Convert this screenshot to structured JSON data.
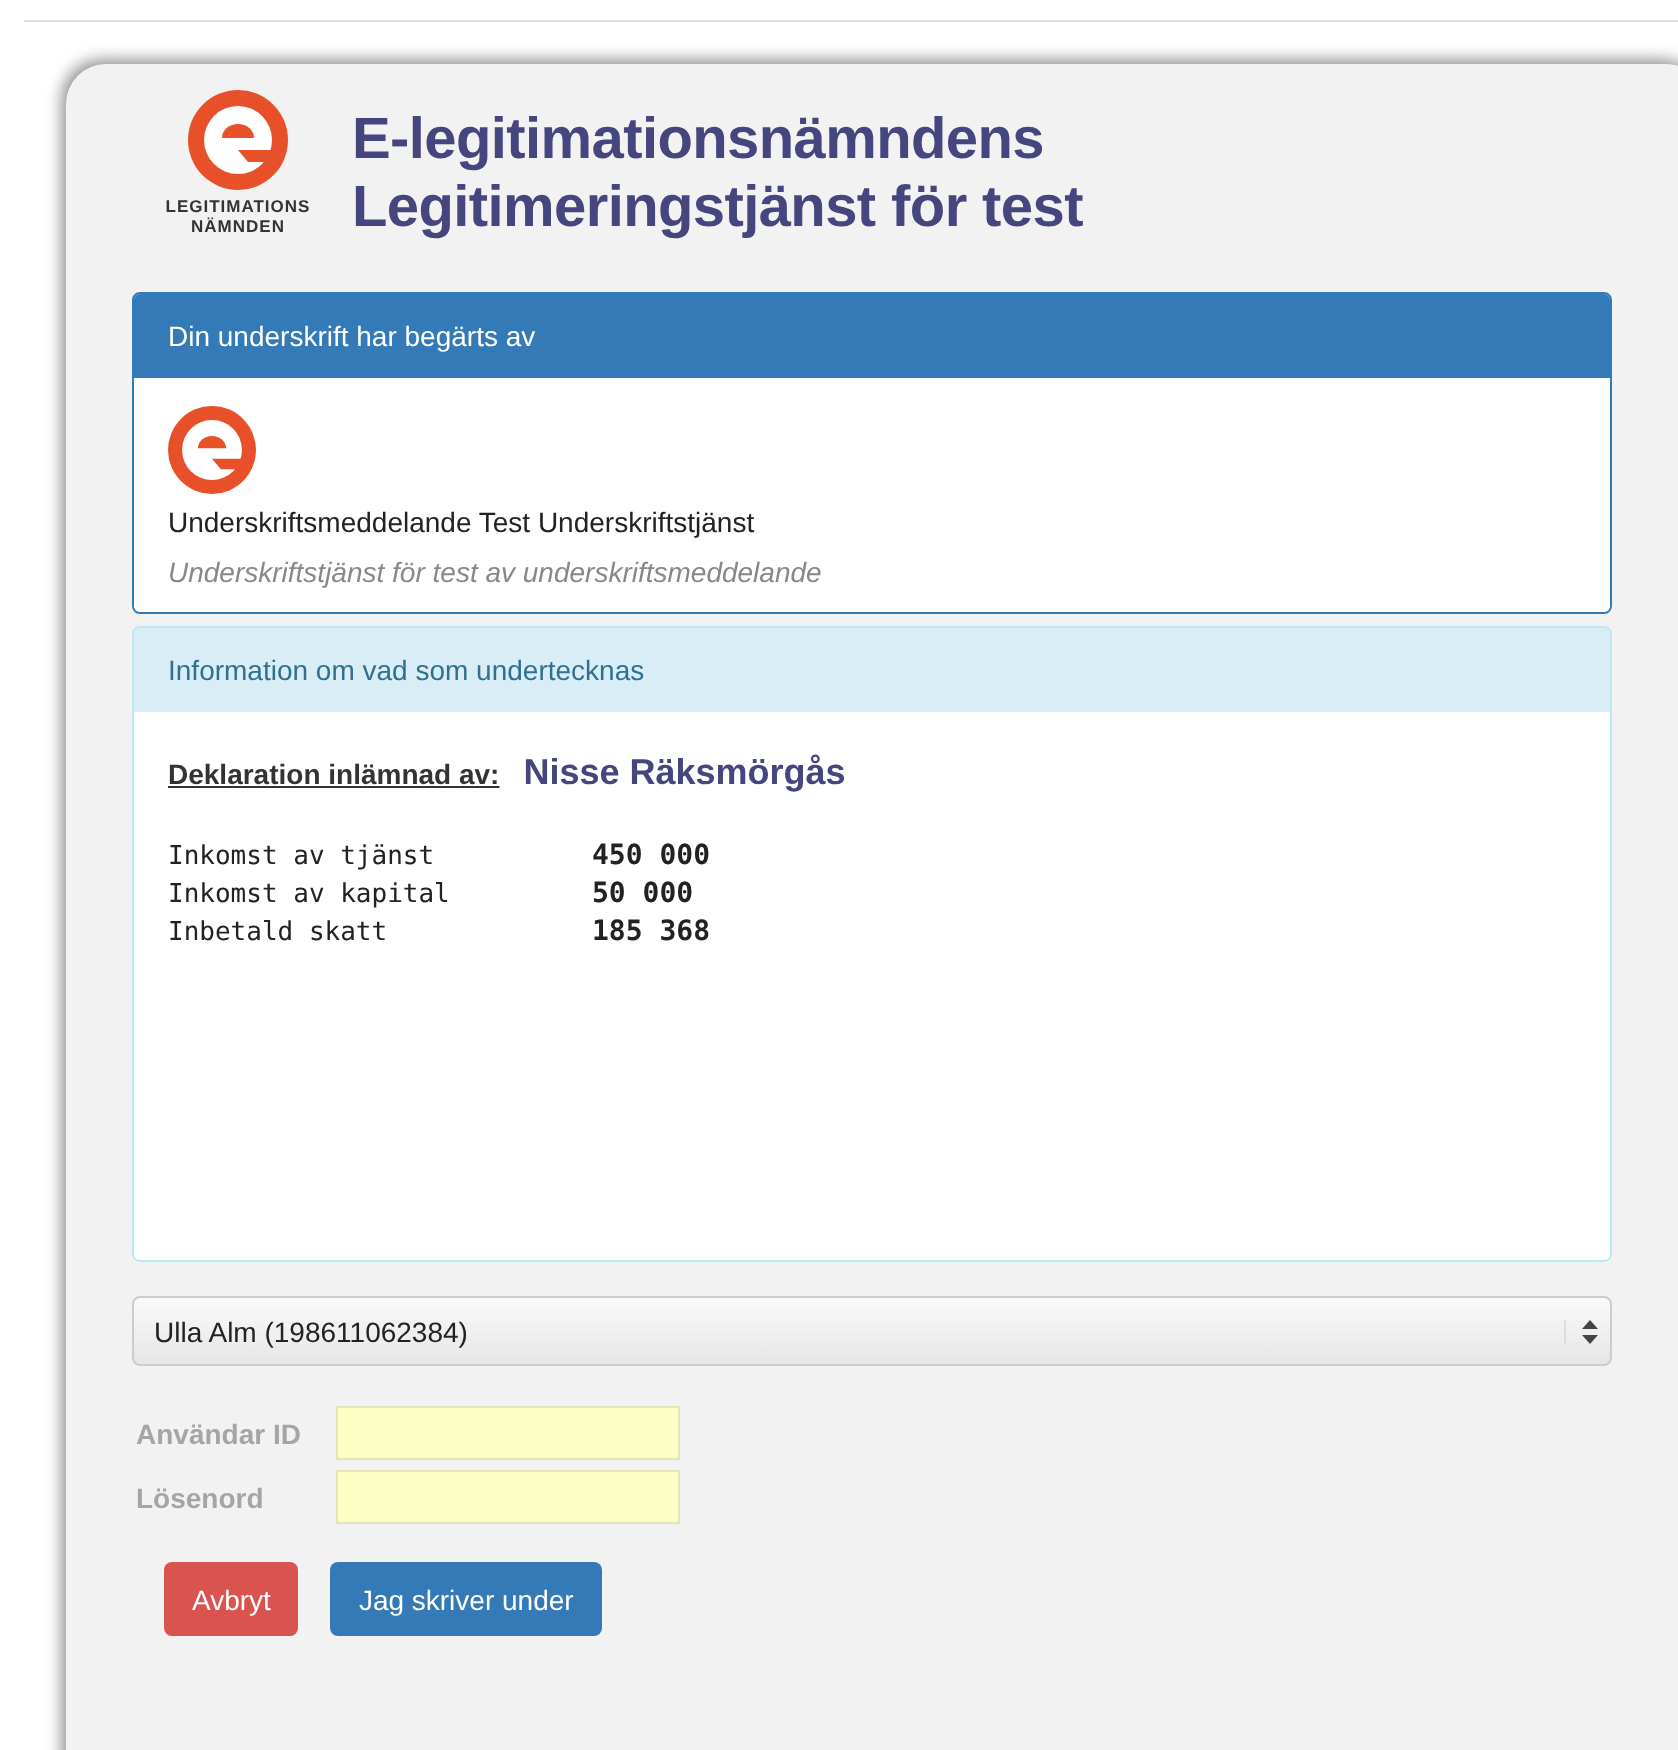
{
  "logo": {
    "line_1": "LEGITIMATIONS",
    "line_2": "NÄMNDEN"
  },
  "title": {
    "line_1": "E-legitimationsnämndens",
    "line_2": "Legitimeringstjänst för test"
  },
  "requester_panel": {
    "heading": "Din underskrift har begärts av",
    "name": "Underskriftsmeddelande Test Underskriftstjänst",
    "description": "Underskriftstjänst för test av underskriftsmeddelande"
  },
  "info_panel": {
    "heading": "Information om vad som undertecknas",
    "label": "Deklaration inlämnad av:",
    "declarant": "Nisse Räksmörgås",
    "rows": [
      {
        "item": "Inkomst av tjänst",
        "amount": "450 000"
      },
      {
        "item": "Inkomst av kapital",
        "amount": "50 000"
      },
      {
        "item": "Inbetald skatt",
        "amount": "185 368"
      }
    ]
  },
  "user_select": {
    "value": "Ulla Alm (198611062384)"
  },
  "fields": [
    {
      "label": "Användar ID",
      "disabled": true
    },
    {
      "label": "Lösenord",
      "disabled": true
    }
  ],
  "buttons": [
    {
      "label": "Avbryt",
      "kind": "danger"
    },
    {
      "label": "Jag skriver under",
      "kind": "primary"
    }
  ]
}
